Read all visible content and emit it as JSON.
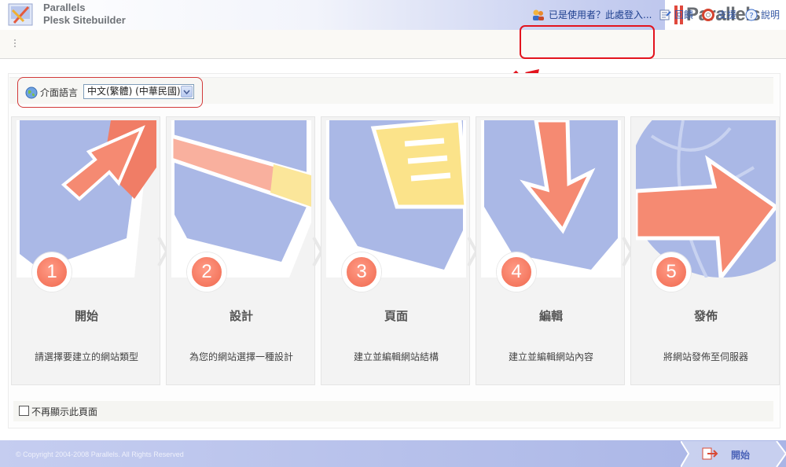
{
  "app": {
    "brand_line1": "Parallels",
    "brand_line2": "Plesk Sitebuilder",
    "vendor_logo_text": "Parallels",
    "vendor_logo_tm": "™"
  },
  "toolbar": {
    "login_label": "已是使用者？此處登入...",
    "feedback_label": "回饋",
    "support_label": "支援",
    "help_label": "說明"
  },
  "language": {
    "label": "介面語言",
    "selected": "中文(繁體) (中華民國)"
  },
  "steps": [
    {
      "number": "1",
      "title": "開始",
      "description": "請選擇要建立的網站類型"
    },
    {
      "number": "2",
      "title": "設計",
      "description": "為您的網站選擇一種設計"
    },
    {
      "number": "3",
      "title": "頁面",
      "description": "建立並編輯網站結構"
    },
    {
      "number": "4",
      "title": "編輯",
      "description": "建立並編輯網站內容"
    },
    {
      "number": "5",
      "title": "發佈",
      "description": "將網站發佈至伺服器"
    }
  ],
  "dont_show_label": "不再顯示此頁面",
  "footer": {
    "copyright": "© Copyright 2004-2008 Parallels. All Rights Reserved",
    "start_label": "開始"
  },
  "colors": {
    "accent_red": "#e3141e",
    "step_orange": "#f0684e",
    "panel_blue": "#a9b5e6"
  }
}
